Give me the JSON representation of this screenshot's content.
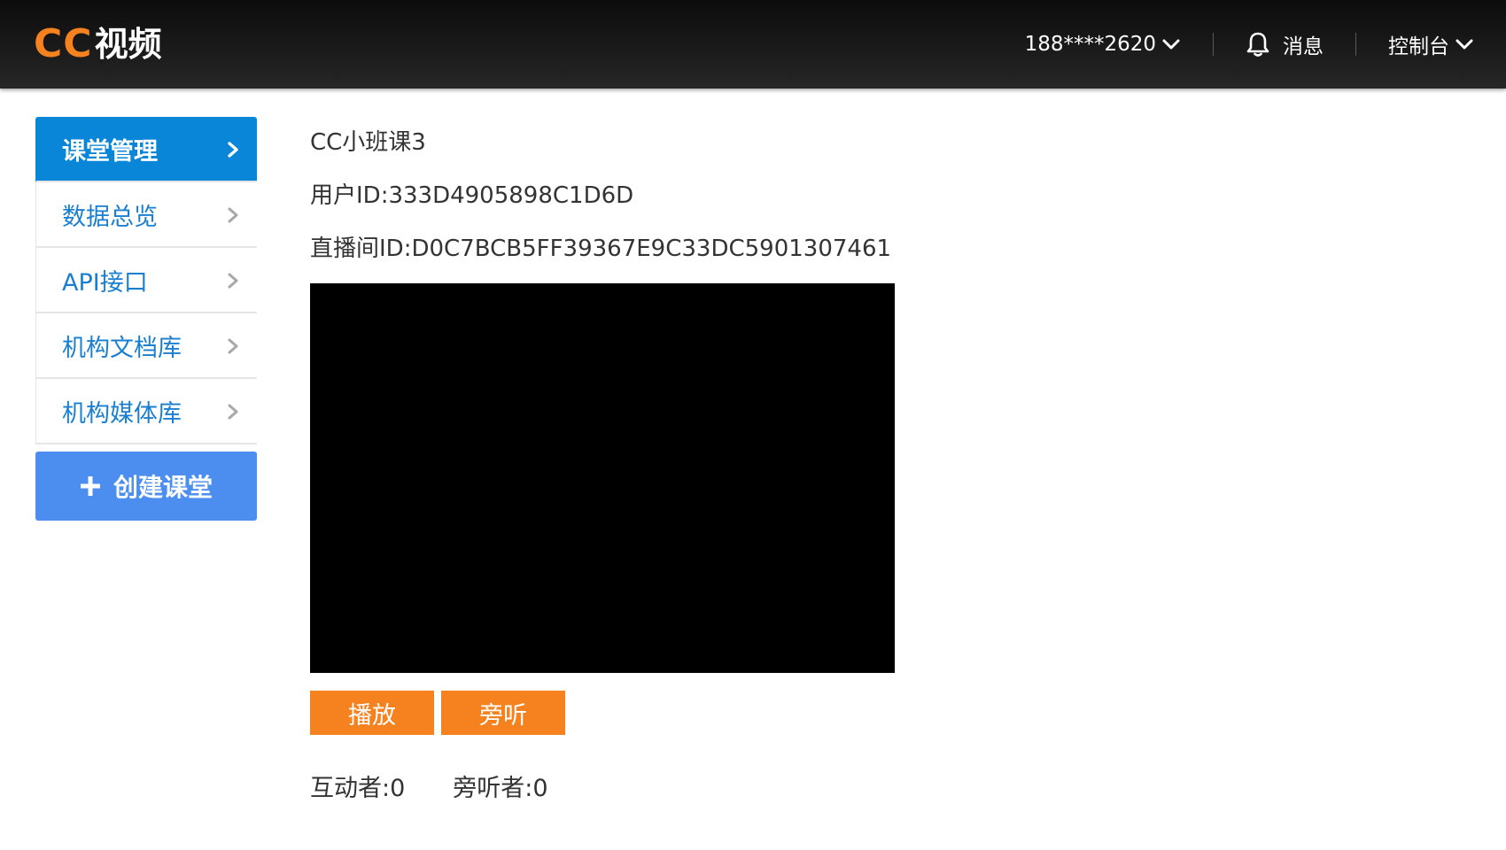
{
  "header": {
    "logo_cc": "CC",
    "logo_text": "视频",
    "user_label": "188****2620",
    "messages_label": "消息",
    "console_label": "控制台"
  },
  "sidebar": {
    "items": [
      {
        "label": "课堂管理",
        "active": true
      },
      {
        "label": "数据总览"
      },
      {
        "label": "API接口"
      },
      {
        "label": "机构文档库"
      },
      {
        "label": "机构媒体库"
      }
    ],
    "create_label": "创建课堂"
  },
  "main": {
    "room_name": "CC小班课3",
    "user_id": "用户ID:333D4905898C1D6D",
    "live_room_id": "直播间ID:D0C7BCB5FF39367E9C33DC5901307461",
    "play_label": "播放",
    "listen_label": "旁听",
    "interactors": "互动者:0",
    "listeners": "旁听者:0"
  },
  "colors": {
    "accent_orange": "#f5821f",
    "nav_active_blue": "#0a86d8",
    "nav_link_blue": "#1a7fd1",
    "create_button_blue": "#4b8ef0",
    "header_bg": "#1a1a1a"
  },
  "icons": [
    "chevron-down-icon",
    "bell-icon",
    "chevron-right-icon",
    "plus-icon"
  ]
}
